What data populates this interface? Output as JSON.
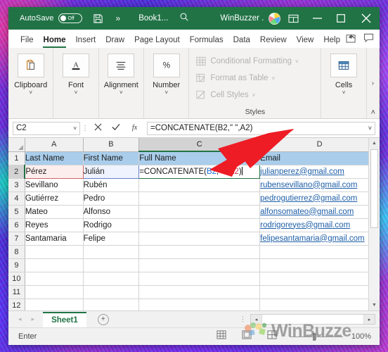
{
  "titlebar": {
    "autosave_label": "AutoSave",
    "autosave_state": "Off",
    "save_icon": "save-icon",
    "overflow_label": "»",
    "document_name": "Book1...",
    "search_icon": "search-icon",
    "user_name": "WinBuzzer .",
    "avatar": "user-avatar",
    "ribbon_display_icon": "ribbon-display-options-icon",
    "minimize_label": "─",
    "maximize_label": "□",
    "close_label": "✕",
    "accent_color": "#217346"
  },
  "ribbon": {
    "tabs": [
      {
        "label": "File",
        "active": false
      },
      {
        "label": "Home",
        "active": true
      },
      {
        "label": "Insert",
        "active": false
      },
      {
        "label": "Draw",
        "active": false
      },
      {
        "label": "Page Layout",
        "active": false
      },
      {
        "label": "Formulas",
        "active": false
      },
      {
        "label": "Data",
        "active": false
      },
      {
        "label": "Review",
        "active": false
      },
      {
        "label": "View",
        "active": false
      },
      {
        "label": "Help",
        "active": false
      }
    ],
    "share_icon": "share-icon",
    "comments_icon": "comments-icon",
    "groups": [
      {
        "label": "Clipboard",
        "icon": "clipboard-icon",
        "caret": "˅"
      },
      {
        "label": "Font",
        "icon": "font-icon",
        "caret": "˅"
      },
      {
        "label": "Alignment",
        "icon": "alignment-icon",
        "caret": "˅"
      },
      {
        "label": "Number",
        "icon": "percent-icon",
        "caret": "˅"
      }
    ],
    "styles": {
      "caption": "Styles",
      "items": [
        {
          "label": "Conditional Formatting",
          "icon": "conditional-formatting-icon",
          "caret": "˅"
        },
        {
          "label": "Format as Table",
          "icon": "format-as-table-icon",
          "caret": "˅"
        },
        {
          "label": "Cell Styles",
          "icon": "cell-styles-icon",
          "caret": "˅"
        }
      ]
    },
    "cells_group": {
      "label": "Cells",
      "icon": "cells-icon",
      "caret": "˅"
    },
    "expand_label": "›",
    "collapse_label": "˄"
  },
  "formula_bar": {
    "name_box_value": "C2",
    "name_box_caret": "˅",
    "cancel_icon": "cancel-x-icon",
    "enter_icon": "confirm-check-icon",
    "function_icon": "fx-icon",
    "formula_value": "=CONCATENATE(B2,\" \",A2)",
    "expand_caret": "˅"
  },
  "grid": {
    "columns": [
      "A",
      "B",
      "C",
      "D"
    ],
    "active_column": "C",
    "active_row": "2",
    "rows": [
      {
        "num": "1",
        "a": "Last Name",
        "b": "First Name",
        "c": "Full Name",
        "d": "Email",
        "style": "header"
      },
      {
        "num": "2",
        "a": "Pérez",
        "b": "Julián",
        "c": "",
        "d": "julianperez@gmail.com",
        "style": "editing"
      },
      {
        "num": "3",
        "a": "Sevillano",
        "b": "Rubén",
        "c": "",
        "d": "rubensevillano@gmail.com",
        "style": "data"
      },
      {
        "num": "4",
        "a": "Gutiérrez",
        "b": "Pedro",
        "c": "",
        "d": "pedrogutierrez@gmail.com",
        "style": "data"
      },
      {
        "num": "5",
        "a": "Mateo",
        "b": "Alfonso",
        "c": "",
        "d": "alfonsomateo@gmail.com",
        "style": "data"
      },
      {
        "num": "6",
        "a": "Reyes",
        "b": "Rodrigo",
        "c": "",
        "d": "rodrigoreyes@gmail.com",
        "style": "data"
      },
      {
        "num": "7",
        "a": "Santamaria",
        "b": "Felipe",
        "c": "",
        "d": "felipesantamaria@gmail.com",
        "style": "data"
      },
      {
        "num": "8",
        "a": "",
        "b": "",
        "c": "",
        "d": "",
        "style": "empty"
      },
      {
        "num": "9",
        "a": "",
        "b": "",
        "c": "",
        "d": "",
        "style": "empty"
      },
      {
        "num": "10",
        "a": "",
        "b": "",
        "c": "",
        "d": "",
        "style": "empty"
      },
      {
        "num": "11",
        "a": "",
        "b": "",
        "c": "",
        "d": "",
        "style": "empty"
      },
      {
        "num": "12",
        "a": "",
        "b": "",
        "c": "",
        "d": "",
        "style": "empty"
      }
    ],
    "editing_cell": {
      "address": "C2",
      "prefix": "=CONCATENATE(",
      "ref1": "B2",
      "middle": ",\" \",",
      "ref2": "A2",
      "suffix": ")",
      "ref1_color": "#1a6fd4",
      "ref2_color": "#d0384e"
    },
    "header_fill": "#a9cdeb",
    "email_link_color": "#1f5fa8",
    "scroll_up_icon": "scroll-up-arrow-icon",
    "scroll_down_icon": "scroll-down-arrow-icon"
  },
  "sheet_tabs": {
    "prev_icon": "◂",
    "next_icon": "▸",
    "tabs": [
      {
        "label": "Sheet1",
        "active": true
      }
    ],
    "add_sheet_label": "+",
    "grip_icon": "⋮",
    "hscroll_left": "◂",
    "hscroll_right": "▸"
  },
  "status_bar": {
    "mode_text": "Enter",
    "view_buttons": [
      {
        "icon": "normal-view-icon"
      },
      {
        "icon": "page-layout-view-icon"
      },
      {
        "icon": "page-break-preview-icon"
      }
    ],
    "zoom_percent": "100%"
  },
  "overlay": {
    "arrow_color": "#ee1c25",
    "arrow_name": "red-annotation-arrow",
    "watermark_text": "WinBuzze",
    "watermark_logo": "winbuzzer-logo"
  }
}
